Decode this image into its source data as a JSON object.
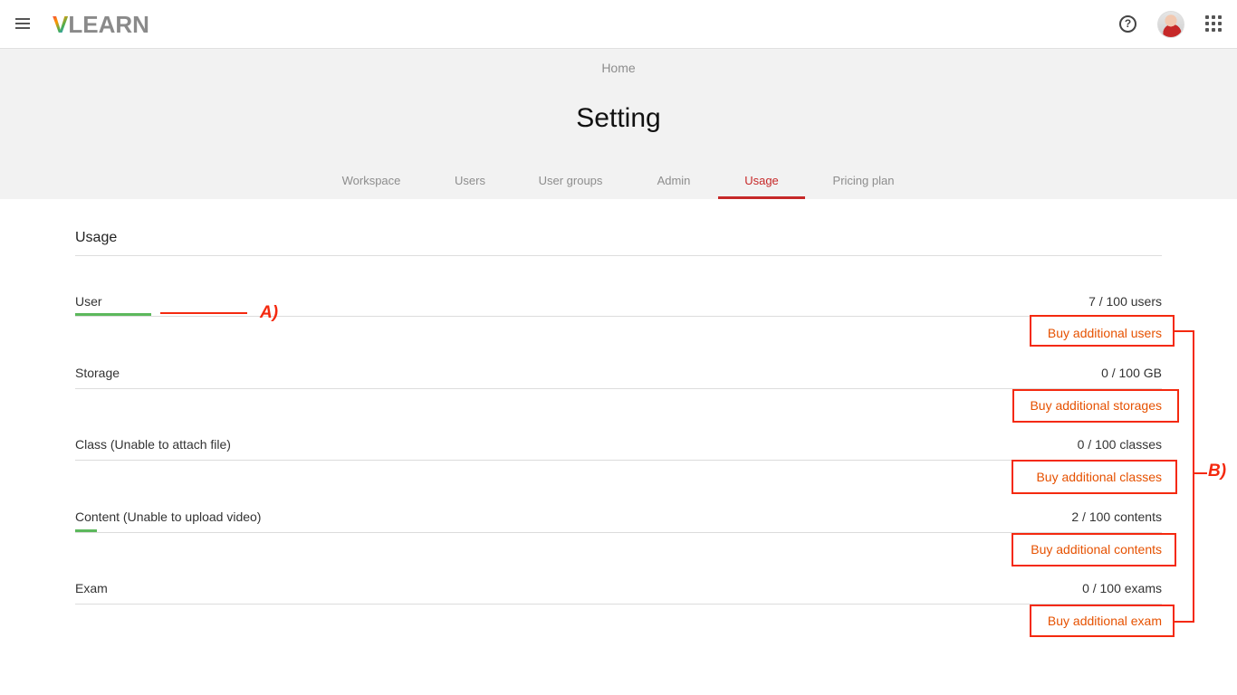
{
  "app": {
    "logo_v": "V",
    "logo_rest": "LEARN"
  },
  "topbar": {
    "help_icon_glyph": "?"
  },
  "breadcrumb": {
    "home": "Home"
  },
  "page": {
    "title": "Setting"
  },
  "tabs": [
    {
      "label": "Workspace",
      "active": false
    },
    {
      "label": "Users",
      "active": false
    },
    {
      "label": "User groups",
      "active": false
    },
    {
      "label": "Admin",
      "active": false
    },
    {
      "label": "Usage",
      "active": true
    },
    {
      "label": "Pricing plan",
      "active": false
    }
  ],
  "usage": {
    "title": "Usage",
    "rows": [
      {
        "label": "User",
        "value": "7 / 100 users",
        "used_fraction": 0.07,
        "buy_label": "Buy additional users"
      },
      {
        "label": "Storage",
        "value": "0 / 100 GB",
        "used_fraction": 0,
        "buy_label": "Buy additional storages"
      },
      {
        "label": "Class (Unable to attach file)",
        "value": "0 / 100 classes",
        "used_fraction": 0,
        "buy_label": "Buy additional classes"
      },
      {
        "label": "Content (Unable to upload video)",
        "value": "2 / 100 contents",
        "used_fraction": 0.02,
        "buy_label": "Buy additional contents"
      },
      {
        "label": "Exam",
        "value": "0 / 100 exams",
        "used_fraction": 0,
        "buy_label": "Buy additional exam"
      }
    ]
  },
  "annotations": {
    "a_label": "A)",
    "b_label": "B)"
  },
  "colors": {
    "accent": "#c62828",
    "progress": "#5cb85c",
    "link": "#e65100",
    "annotation": "#f4290f"
  }
}
